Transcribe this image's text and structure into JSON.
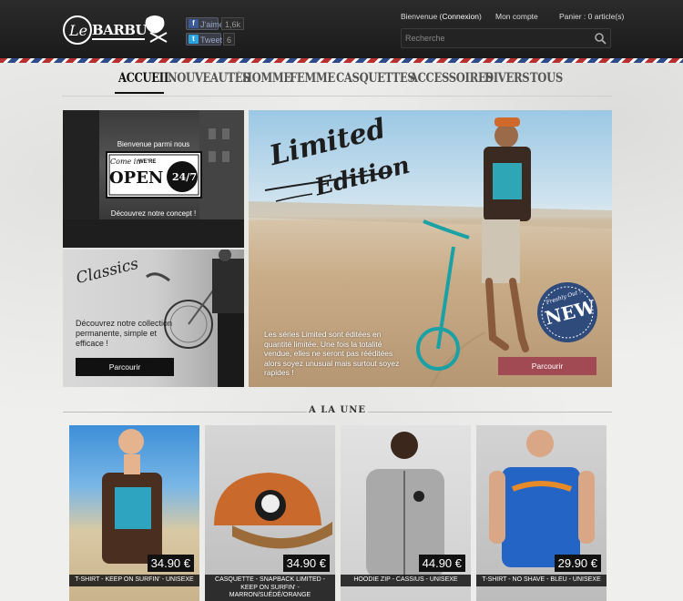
{
  "header": {
    "logo_text": "Le BARBU",
    "facebook": {
      "label": "J'aime",
      "count": "1,6k"
    },
    "twitter": {
      "label": "Tweet",
      "count": "6"
    },
    "welcome_prefix": "Bienvenue",
    "login_link": "Connexion",
    "account_link": "Mon compte",
    "cart_label": "Panier : 0 article(s)",
    "search_placeholder": "Recherche"
  },
  "nav": {
    "items": [
      "ACCUEIL",
      "NOUVEAUTÉS",
      "HOMME",
      "FEMME",
      "CASQUETTES",
      "ACCESSOIRES",
      "DIVERS",
      "TOUS"
    ]
  },
  "promo": {
    "concept": {
      "welcome": "Bienvenue parmi nous",
      "sign_top": "Come in",
      "sign_mid": "WE'RE",
      "sign_open": "OPEN",
      "sign_hours": "24/7",
      "cta": "Découvrez notre concept !"
    },
    "classics": {
      "title": "Classics",
      "text": "Découvrez notre collection permanente, simple et efficace !",
      "button": "Parcourir"
    },
    "limited": {
      "title_line1": "Limited",
      "title_line2": "Edition",
      "text": "Les séries Limited sont éditées en quantité limitée. Une fois la totalité vendue, elles ne seront pas rééditées alors soyez unusual mais surtout soyez rapides !",
      "button": "Parcourir",
      "badge_top": "Freshly Out !",
      "badge": "NEW"
    }
  },
  "featured": {
    "title": "A LA UNE",
    "products": [
      {
        "name": "T-SHIRT - KEEP ON SURFIN' - UNISEXE",
        "price": "34.90 €"
      },
      {
        "name": "CASQUETTE - SNAPBACK LIMITED - KEEP ON SURFIN' - MARRON/SUÉDÉ/ORANGE",
        "price": "34.90 €"
      },
      {
        "name": "HOODIE ZIP - CASSIUS - UNISEXE",
        "price": "44.90 €"
      },
      {
        "name": "T-SHIRT - NO SHAVE - BLEU - UNISEXE",
        "price": "29.90 €"
      }
    ]
  },
  "colors": {
    "accent_red": "#a24a54",
    "header": "#1d1d1d",
    "stripe_red": "#b92e2e",
    "stripe_blue": "#2e4a8a"
  }
}
